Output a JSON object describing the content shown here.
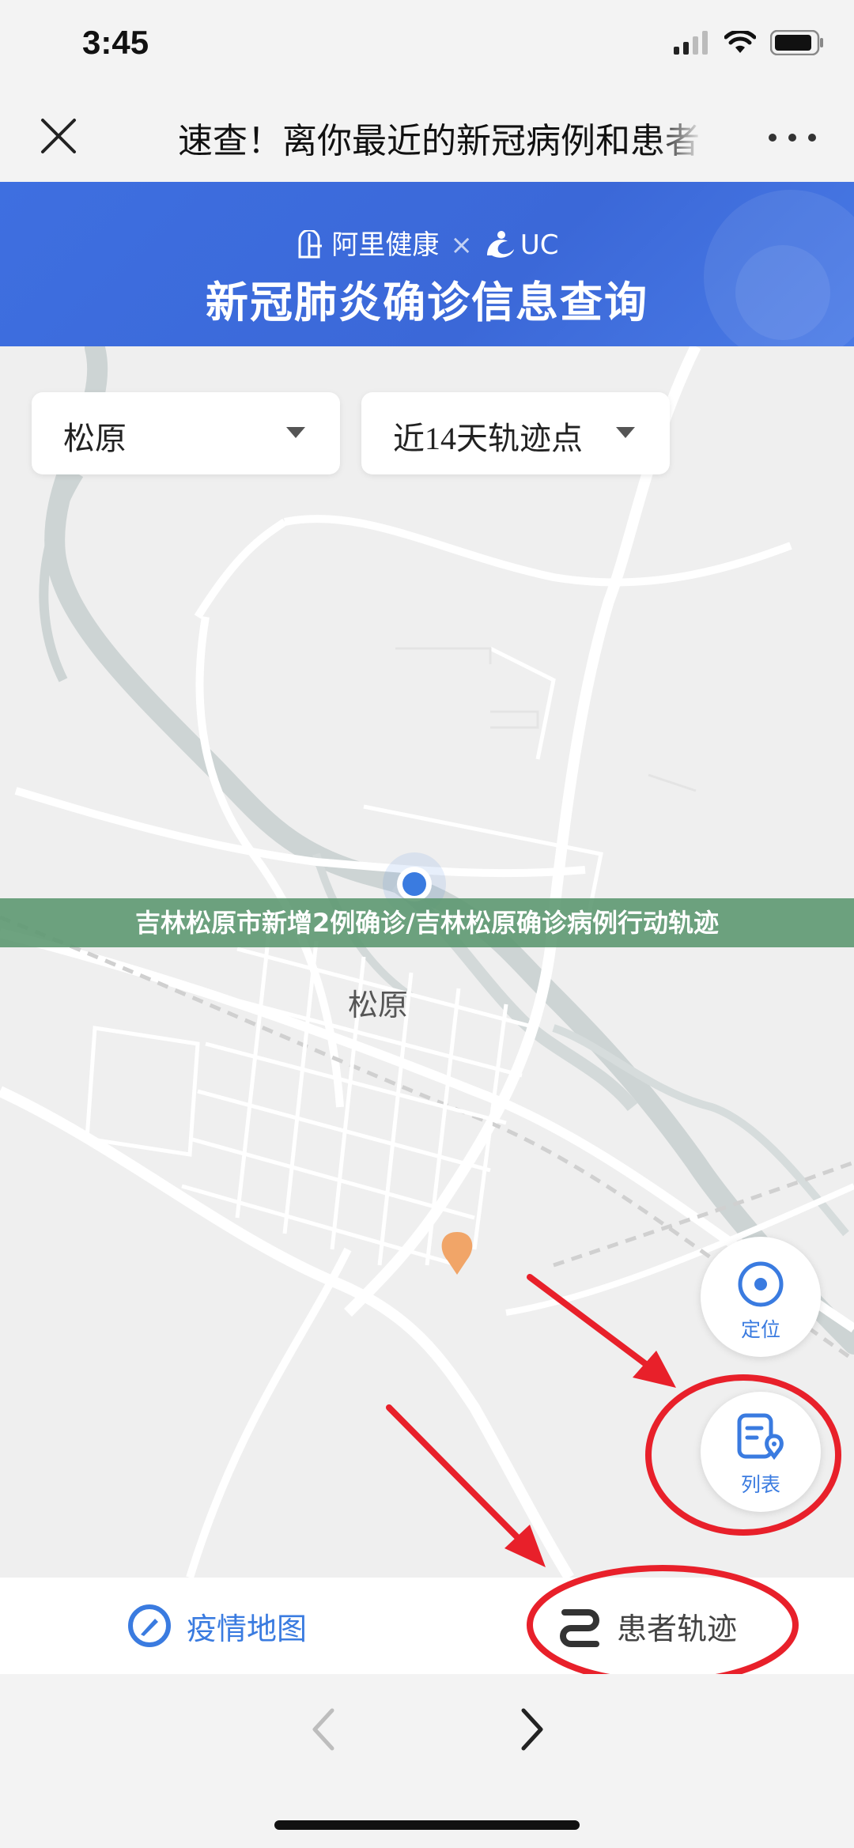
{
  "status_bar": {
    "time": "3:45"
  },
  "nav": {
    "title": "速查！离你最近的新冠病例和患者"
  },
  "banner": {
    "brand_left": "阿里健康",
    "brand_sep": "×",
    "brand_right": "UC",
    "title": "新冠肺炎确诊信息查询"
  },
  "filters": {
    "city": "松原",
    "period": "近14天轨迹点"
  },
  "overlay": {
    "caption": "吉林松原市新增2例确诊/吉林松原确诊病例行动轨迹"
  },
  "map": {
    "city_label": "松原"
  },
  "fabs": {
    "locate_label": "定位",
    "list_label": "列表"
  },
  "tabs": {
    "map_label": "疫情地图",
    "track_label": "患者轨迹"
  },
  "colors": {
    "accent": "#3a7be0",
    "banner": "#3e6fe0",
    "annotation": "#e8202a",
    "marker": "#f0a060"
  }
}
